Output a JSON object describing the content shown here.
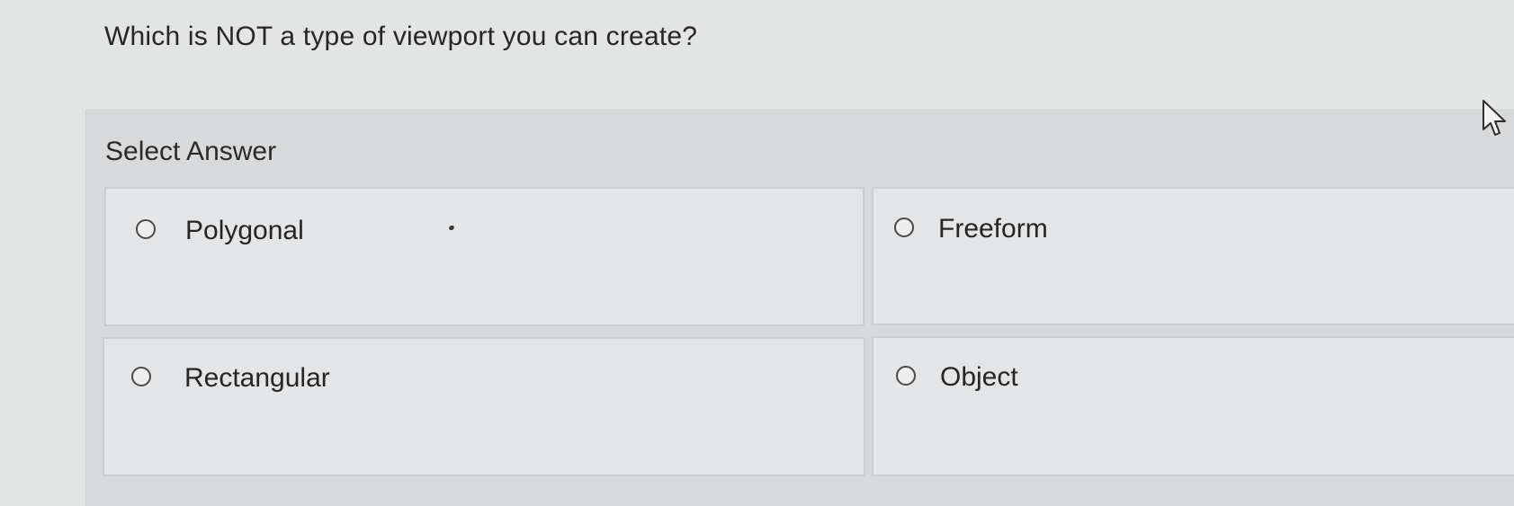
{
  "question": {
    "text": "Which is NOT a type of viewport you can create?"
  },
  "answer_section": {
    "label": "Select Answer",
    "options": [
      {
        "label": "Polygonal",
        "selected": false
      },
      {
        "label": "Freeform",
        "selected": false
      },
      {
        "label": "Rectangular",
        "selected": false
      },
      {
        "label": "Object",
        "selected": false
      }
    ]
  },
  "icons": {
    "cursor": "mouse-pointer-icon",
    "radio": "radio-button-icon"
  },
  "colors": {
    "page_background": "#e3e4e4",
    "panel_background": "#d8d9da",
    "option_background": "#e4e5e6",
    "option_border": "#cdced0",
    "text": "#262626"
  }
}
